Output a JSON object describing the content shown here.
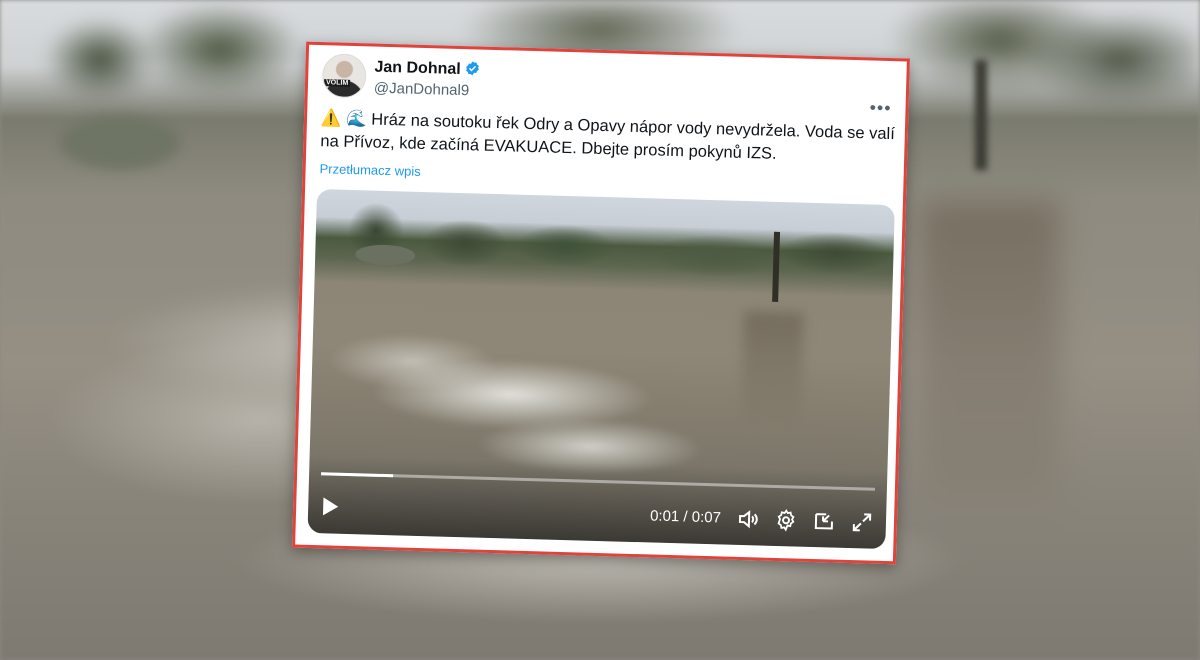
{
  "tweet": {
    "author_name": "Jan Dohnal",
    "handle": "@JanDohnal9",
    "avatar_label": "VOLIM",
    "more_label": "•••",
    "emoji_warning": "⚠️",
    "emoji_wave": "🌊",
    "text": "Hráz na soutoku řek Odry a Opavy nápor vody nevydržela. Voda se valí na Přívoz, kde začíná EVAKUACE. Dbejte prosím pokynů IZS.",
    "translate_label": "Przetłumacz wpis"
  },
  "video": {
    "current_time": "0:01",
    "separator": "/",
    "duration": "0:07",
    "progress_fraction": 0.13,
    "icons": [
      "play-icon",
      "volume-icon",
      "settings-icon",
      "pip-icon",
      "fullscreen-icon"
    ]
  },
  "colors": {
    "frame_border": "#e0433b",
    "link": "#1d9bf0",
    "verified": "#1d9bf0"
  }
}
